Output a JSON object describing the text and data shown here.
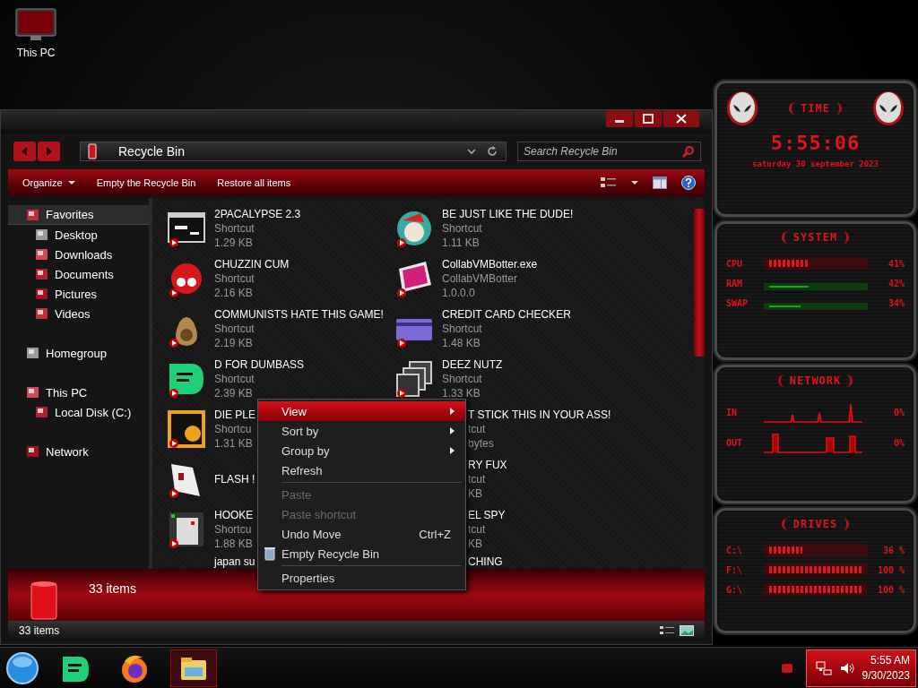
{
  "desktop": {
    "icons": [
      {
        "label": "This PC"
      }
    ]
  },
  "explorer": {
    "address": "Recycle Bin",
    "search": {
      "placeholder": "Search Recycle Bin"
    },
    "toolbar": [
      {
        "label": "Organize",
        "dropdown": true
      },
      {
        "label": "Empty the Recycle Bin",
        "dropdown": false
      },
      {
        "label": "Restore all items",
        "dropdown": false
      }
    ],
    "sidebar": {
      "items": [
        {
          "label": "Favorites",
          "selected": true,
          "children": [
            {
              "label": "Desktop",
              "selected": false
            },
            {
              "label": "Downloads",
              "selected": false
            },
            {
              "label": "Documents",
              "selected": false
            },
            {
              "label": "Pictures",
              "selected": false
            },
            {
              "label": "Videos",
              "selected": false
            }
          ]
        },
        {
          "label": "Homegroup",
          "selected": false
        },
        {
          "label": "This PC",
          "selected": false,
          "children": [
            {
              "label": "Local Disk (C:)",
              "selected": false
            }
          ]
        },
        {
          "label": "Network",
          "selected": false
        }
      ]
    },
    "items": [
      {
        "kind": "file",
        "name": "2PACALYPSE 2.3",
        "type": "Shortcut",
        "size": "1.29 KB"
      },
      {
        "kind": "file",
        "name": "BE JUST LIKE THE DUDE!",
        "type": "Shortcut",
        "size": "1.11 KB"
      },
      {
        "kind": "file",
        "name": "CHUZZIN CUM",
        "type": "Shortcut",
        "size": "2.16 KB"
      },
      {
        "kind": "file",
        "name": "CollabVMBotter.exe",
        "type": "CollabVMBotter",
        "size": "1.0.0.0"
      },
      {
        "kind": "file",
        "name": "COMMUNISTS HATE THIS GAME!",
        "type": "Shortcut",
        "size": "2.19 KB"
      },
      {
        "kind": "file",
        "name": "CREDIT CARD CHECKER",
        "type": "Shortcut",
        "size": "1.48 KB"
      },
      {
        "kind": "file",
        "name": "D FOR DUMBASS",
        "type": "Shortcut",
        "size": "2.39 KB"
      },
      {
        "kind": "file",
        "name": "DEEZ NUTZ",
        "type": "Shortcut",
        "size": "1.33 KB"
      },
      {
        "kind": "file",
        "name": "DIE PLE",
        "type": "Shortcu",
        "size": "1.31 KB"
      },
      {
        "kind": "partial",
        "name": "T STICK THIS IN YOUR ASS!",
        "type": "tcut",
        "size": "bytes"
      },
      {
        "kind": "file",
        "name": "FLASH !"
      },
      {
        "kind": "partial",
        "name": "RY FUX",
        "type": "tcut",
        "size": "KB"
      },
      {
        "kind": "file",
        "name": "HOOKE",
        "type": "Shortcu",
        "size": "1.88 KB"
      },
      {
        "kind": "partial",
        "name": "EL SPY",
        "type": "tcut",
        "size": "KB"
      },
      {
        "kind": "cut",
        "name": "japan su"
      },
      {
        "kind": "partial",
        "name": "CHING"
      }
    ],
    "details": {
      "count": "33 items"
    },
    "status_bar": {
      "count": "33 items"
    }
  },
  "context_menu": {
    "items": [
      {
        "kind": "submenu",
        "label": "View",
        "selected": true,
        "disabled": false
      },
      {
        "kind": "submenu",
        "label": "Sort by",
        "selected": false,
        "disabled": false
      },
      {
        "kind": "submenu",
        "label": "Group by",
        "selected": false,
        "disabled": false
      },
      {
        "kind": "command",
        "label": "Refresh",
        "selected": false,
        "disabled": false
      },
      {
        "kind": "separator"
      },
      {
        "kind": "command",
        "label": "Paste",
        "selected": false,
        "disabled": true
      },
      {
        "kind": "command",
        "label": "Paste shortcut",
        "selected": false,
        "disabled": true
      },
      {
        "kind": "command",
        "label": "Undo Move",
        "shortcut": "Ctrl+Z",
        "selected": false,
        "disabled": false
      },
      {
        "kind": "iconed",
        "label": "Empty Recycle Bin",
        "selected": false,
        "disabled": false
      },
      {
        "kind": "separator"
      },
      {
        "kind": "command",
        "label": "Properties",
        "selected": false,
        "disabled": false
      }
    ]
  },
  "widgets": {
    "time": {
      "title": "TIME",
      "clock": "5:55:06",
      "date": "saturday 30 september 2023"
    },
    "system": {
      "title": "SYSTEM",
      "rows": [
        {
          "label": "CPU",
          "kind": "chevrons",
          "level": 0.41,
          "value": "41%"
        },
        {
          "label": "RAM",
          "kind": "line",
          "level": 0.42,
          "value": "42%"
        },
        {
          "label": "SWAP",
          "kind": "line",
          "level": 0.34,
          "value": "34%"
        }
      ]
    },
    "network": {
      "title": "NETWORK",
      "rows": [
        {
          "label": "IN",
          "value": "0%"
        },
        {
          "label": "OUT",
          "value": "0%"
        }
      ]
    },
    "drives": {
      "title": "DRIVES",
      "rows": [
        {
          "label": "C:\\",
          "level": 0.36,
          "value": "36 %"
        },
        {
          "label": "F:\\",
          "level": 1,
          "value": "100 %"
        },
        {
          "label": "G:\\",
          "level": 1,
          "value": "100 %"
        }
      ]
    }
  },
  "taskbar": {
    "apps": [
      {
        "kind": "chat",
        "selected": false
      },
      {
        "kind": "browser",
        "selected": false
      },
      {
        "kind": "explorer",
        "selected": true
      }
    ],
    "clock": {
      "time": "5:55 AM",
      "date": "9/30/2023"
    }
  }
}
